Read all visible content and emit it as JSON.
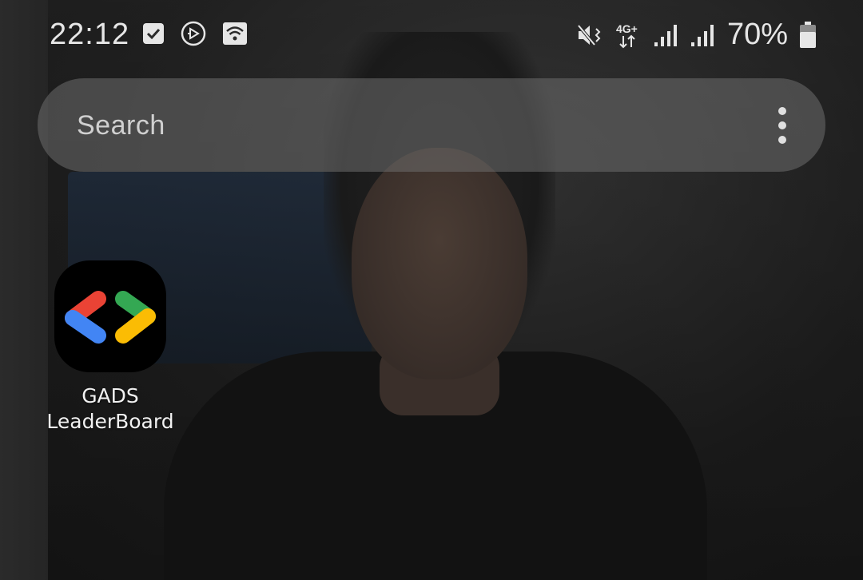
{
  "status_bar": {
    "time": "22:12",
    "left_icons": [
      "checkbox-icon",
      "play-circle-icon",
      "wifi-box-icon"
    ],
    "right_icons": [
      "vibrate-icon",
      "4g-plus-icon",
      "signal-icon",
      "signal-icon"
    ],
    "network_label": "4G+",
    "battery_percent": "70%",
    "battery_level": 0.7
  },
  "search": {
    "placeholder": "Search",
    "more_icon": "more-vert-icon"
  },
  "apps": [
    {
      "label": "GADS\nLeaderBoard",
      "icon": "gads-logo-icon",
      "colors": {
        "red": "#ea4335",
        "blue": "#4285f4",
        "green": "#34a853",
        "yellow": "#fbbc04"
      }
    }
  ]
}
